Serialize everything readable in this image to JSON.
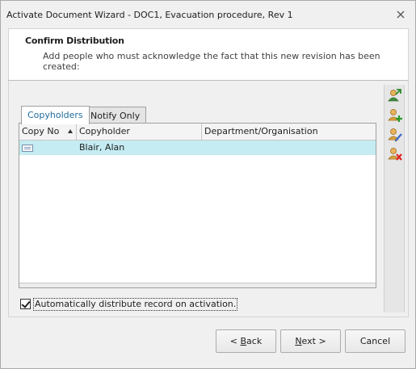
{
  "window": {
    "title": "Activate Document Wizard - DOC1, Evacuation procedure, Rev 1"
  },
  "header": {
    "title": "Confirm Distribution",
    "subtitle": "Add people who must acknowledge the fact that this new revision has been created:"
  },
  "tabs": [
    {
      "label": "Copyholders",
      "active": true
    },
    {
      "label": "Notify Only",
      "active": false
    }
  ],
  "grid": {
    "columns": [
      "Copy No",
      "Copyholder",
      "Department/Organisation"
    ],
    "sort_column": "Copy No",
    "rows": [
      {
        "copy_no_icon": "document-icon",
        "copyholder": "Blair, Alan",
        "department": ""
      }
    ]
  },
  "toolbar": {
    "buttons": [
      "import-users-icon",
      "add-user-icon",
      "edit-user-icon",
      "remove-user-icon"
    ]
  },
  "options": {
    "auto_distribute_label": "Automatically distribute record on activation.",
    "auto_distribute_checked": true
  },
  "buttons": {
    "back_prefix": "< ",
    "back_accel": "B",
    "back_rest": "ack",
    "next_accel": "N",
    "next_rest": "ext >",
    "cancel": "Cancel"
  },
  "colors": {
    "selected_row": "#c4ecf2",
    "active_tab_text": "#1f6b9c"
  }
}
